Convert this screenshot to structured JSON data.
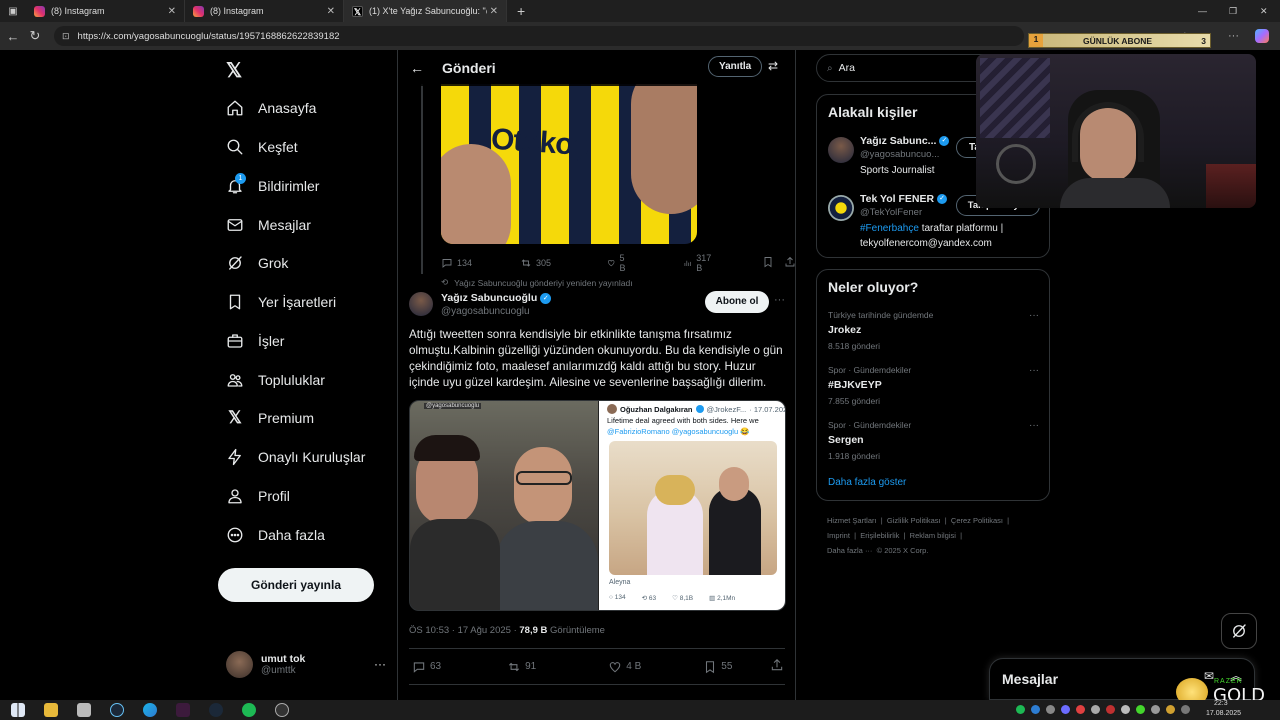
{
  "browser": {
    "tabs": [
      {
        "label": "(8) Instagram",
        "icon": "instagram-icon"
      },
      {
        "label": "(8) Instagram",
        "icon": "instagram-icon"
      },
      {
        "label": "(1) X'te Yağız Sabuncuoğlu: \"@Te",
        "icon": "x-icon"
      }
    ],
    "url": "https://x.com/yagosabuncuoglu/status/1957168862622839182"
  },
  "overlay": {
    "sub_rank": "1",
    "sub_label": "GÜNLÜK ABONE",
    "sub_count": "3"
  },
  "nav": {
    "items": [
      {
        "label": "Anasayfa",
        "icon": "home-icon"
      },
      {
        "label": "Keşfet",
        "icon": "search-icon"
      },
      {
        "label": "Bildirimler",
        "icon": "bell-icon"
      },
      {
        "label": "Mesajlar",
        "icon": "mail-icon"
      },
      {
        "label": "Grok",
        "icon": "grok-icon"
      },
      {
        "label": "Yer İşaretleri",
        "icon": "bookmark-icon"
      },
      {
        "label": "İşler",
        "icon": "briefcase-icon"
      },
      {
        "label": "Topluluklar",
        "icon": "people-icon"
      },
      {
        "label": "Premium",
        "icon": "x-icon"
      },
      {
        "label": "Onaylı Kuruluşlar",
        "icon": "lightning-icon"
      },
      {
        "label": "Profil",
        "icon": "person-icon"
      },
      {
        "label": "Daha fazla",
        "icon": "more-circle-icon"
      }
    ],
    "notification_badge": "1",
    "post_button": "Gönderi yayınla",
    "account": {
      "name": "umut tok",
      "handle": "@umttk"
    }
  },
  "main": {
    "header_title": "Gönderi",
    "reply_button": "Yanıtla",
    "top_image_text": "Otokoç",
    "prev_tweet_actions": {
      "replies": "134",
      "retweets": "305",
      "likes": "5 B",
      "views": "317 B"
    },
    "repost_note": "Yağız Sabuncuoğlu gönderiyi yeniden yayınladı",
    "tweet": {
      "author_name": "Yağız Sabuncuoğlu",
      "author_handle": "@yagosabuncuoglu",
      "subscribe_button": "Abone ol",
      "text": "Attığı tweetten sonra kendisiyle bir etkinlikte tanışma fırsatımız olmuştu.Kalbinin güzelliği yüzünden okunuyordu. Bu da kendisiyle o gün çekindiğimiz foto, maalesef anılarımızdğ kaldı attığı bu story. Huzur içinde uyu güzel kardeşim. Ailesine ve sevenlerine başsağlığı dilerim.",
      "photo_left_watermark": "@yagosabuncuoglu",
      "embedded": {
        "name": "Oğuzhan Dalgakıran",
        "handle": "@JrokezF...",
        "date": "· 17.07.202",
        "text_line1": "Lifetime deal agreed with both sides. Here we",
        "text_line2": "@FabrizioRomano @yagosabuncuoglu 😂",
        "caption": "Aleyna",
        "stats": {
          "replies": "134",
          "retweets": "63",
          "likes": "8,1B",
          "views": "2,1Mn"
        }
      },
      "timestamp": "ÖS 10:53 · 17 Ağu 2025 · ",
      "views_count": "78,9 B",
      "views_label": " Görüntüleme",
      "actions": {
        "replies": "63",
        "retweets": "91",
        "likes": "4 B",
        "bookmarks": "55"
      }
    }
  },
  "right": {
    "search_placeholder": "Ara",
    "related": {
      "title": "Alakalı kişiler",
      "people": [
        {
          "name": "Yağız Sabunc...",
          "handle": "@yagosabuncuo...",
          "bio": "Sports Journalist",
          "button": "Ta"
        },
        {
          "name": "Tek Yol FENER",
          "handle": "@TekYolFener",
          "bio_tag": "#Fenerbahçe",
          "bio_rest": " taraftar platformu |",
          "bio_line2": "tekyolfenercom@yandex.com",
          "button": "Takip ediliyor"
        }
      ]
    },
    "trends": {
      "title": "Neler oluyor?",
      "items": [
        {
          "meta": "Türkiye tarihinde gündemde",
          "title": "Jrokez",
          "count": "8.518 gönderi"
        },
        {
          "meta": "Spor · Gündemdekiler",
          "title": "#BJKvEYP",
          "count": "7.855 gönderi"
        },
        {
          "meta": "Spor · Gündemdekiler",
          "title": "Sergen",
          "count": "1.918 gönderi"
        }
      ],
      "show_more": "Daha fazla göster"
    },
    "footer": {
      "line1": "Hizmet Şartları  |  Gizlilik Politikası  |  Çerez Politikası  |",
      "line2": "Imprint  |  Erişilebilirlik  |  Reklam bilgisi  |",
      "line3": "Daha fazla ···  © 2025 X Corp."
    },
    "messages_title": "Mesajlar"
  },
  "taskbar": {
    "overlay_brand": "GOLD",
    "overlay_brand_small": "RAZER",
    "clock_time": "22:3",
    "clock_date": "17.08.2025"
  },
  "colors": {
    "accent": "#1d9bf0",
    "fener_yellow": "#f5d90a",
    "fener_navy": "#14203e"
  }
}
